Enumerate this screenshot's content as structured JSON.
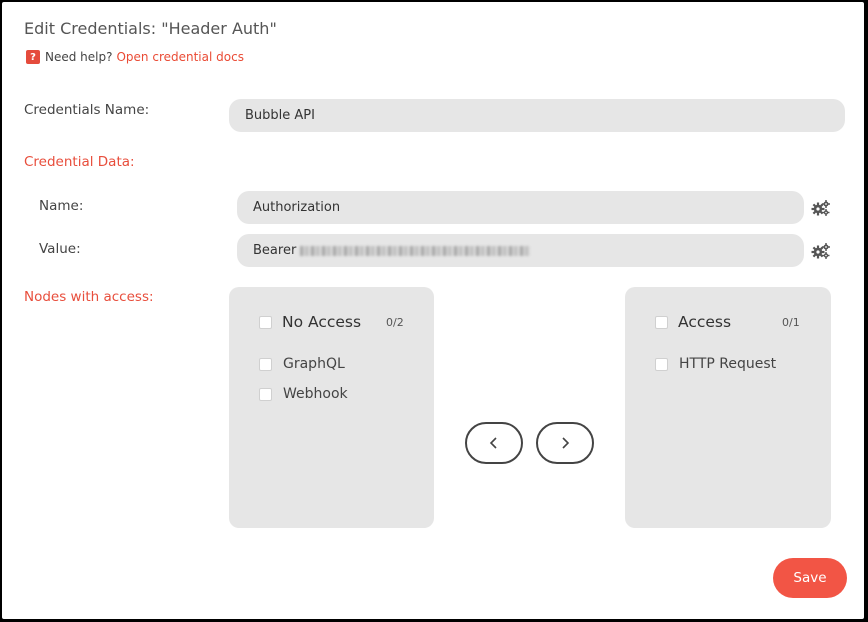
{
  "dialog": {
    "title": "Edit Credentials: \"Header Auth\"",
    "help": {
      "prefix": "Need help?",
      "link": "Open credential docs"
    }
  },
  "credentials_name": {
    "label": "Credentials Name:",
    "value": "Bubble API"
  },
  "credential_data": {
    "label": "Credential Data:",
    "name": {
      "label": "Name:",
      "value": "Authorization"
    },
    "value": {
      "label": "Value:",
      "value": "Bearer"
    }
  },
  "nodes": {
    "label": "Nodes with access:",
    "no_access": {
      "title": "No Access",
      "count": "0/2",
      "items": [
        "GraphQL",
        "Webhook"
      ]
    },
    "access": {
      "title": "Access",
      "count": "0/1",
      "items": [
        "HTTP Request"
      ]
    }
  },
  "save_label": "Save",
  "colors": {
    "accent": "#f25545",
    "panel": "#e6e6e6"
  }
}
